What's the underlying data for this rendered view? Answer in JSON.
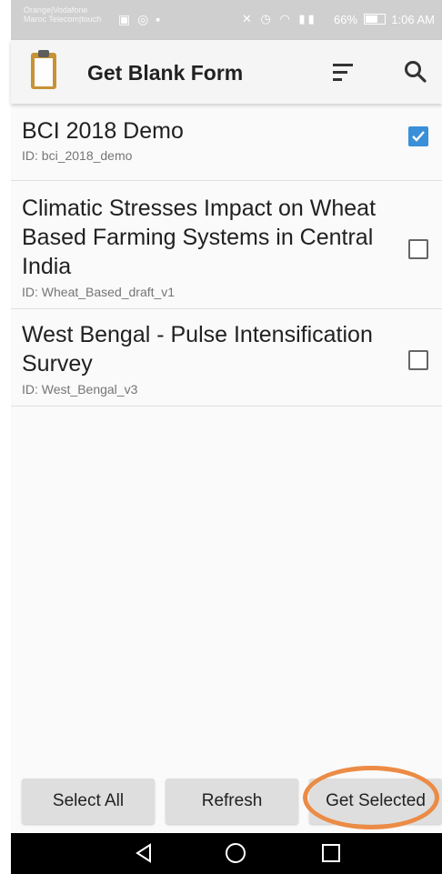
{
  "status_bar": {
    "carrier_line1": "Orange|Vodafone",
    "carrier_line2": "Maroc Telecom|touch",
    "battery": "66%",
    "time": "1:06 AM",
    "signal": "‣‣"
  },
  "toolbar": {
    "title": "Get Blank Form",
    "icons": [
      "clipboard-logo-icon",
      "sort-icon",
      "search-icon"
    ]
  },
  "forms": [
    {
      "title": "BCI 2018 Demo",
      "id_text": "ID: bci_2018_demo",
      "checked": true
    },
    {
      "title": "Climatic Stresses Impact on Wheat Based Farming Systems in Central India",
      "id_text": "ID: Wheat_Based_draft_v1",
      "checked": false
    },
    {
      "title": "West Bengal - Pulse Intensification Survey",
      "id_text": "ID: West_Bengal_v3",
      "checked": false
    }
  ],
  "buttons": {
    "select_all": "Select All",
    "refresh": "Refresh",
    "get_selected": "Get Selected"
  },
  "colors": {
    "accent_check": "#3a8fd9",
    "highlight": "#ec8b45",
    "logo": "#c89236"
  }
}
